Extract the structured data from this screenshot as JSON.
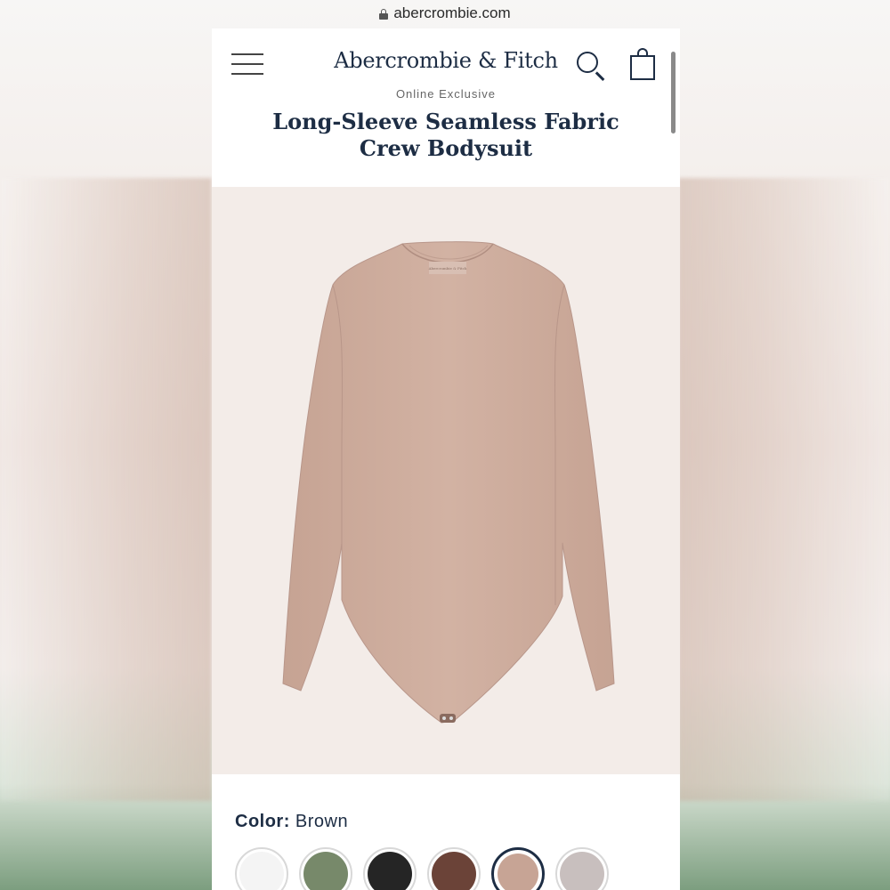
{
  "browser": {
    "url": "abercrombie.com"
  },
  "header": {
    "logo": "Abercrombie & Fitch"
  },
  "product": {
    "badge": "Online Exclusive",
    "title": "Long-Sleeve Seamless Fabric Crew Bodysuit",
    "image_tag": "Abercrombie & Fitch"
  },
  "color": {
    "label": "Color:",
    "selected": "Brown",
    "swatches": [
      {
        "name": "white",
        "hex": "#f4f4f4"
      },
      {
        "name": "green",
        "hex": "#77896a"
      },
      {
        "name": "black",
        "hex": "#252525"
      },
      {
        "name": "dark brown",
        "hex": "#6b4338"
      },
      {
        "name": "brown",
        "hex": "#c7a495",
        "selected": true
      },
      {
        "name": "light gray",
        "hex": "#c8bfbe"
      }
    ]
  },
  "colors": {
    "brand_navy": "#1d2d44",
    "garment": "#cfae9f"
  }
}
